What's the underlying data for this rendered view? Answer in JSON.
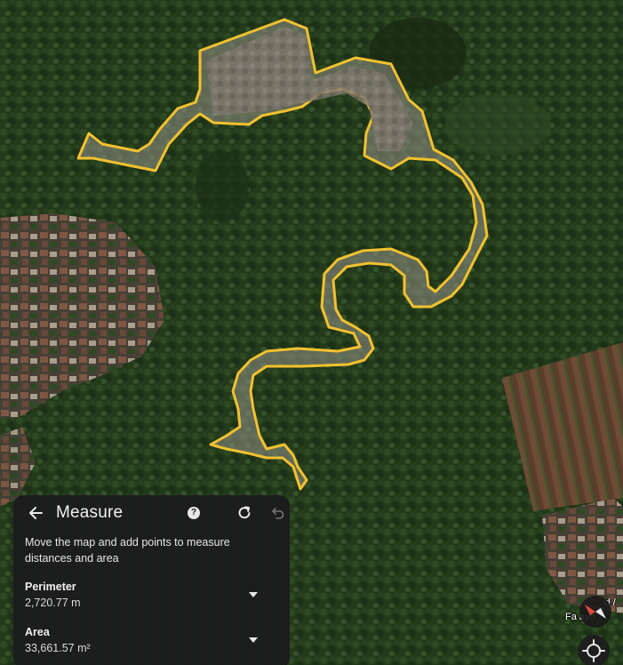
{
  "panel": {
    "title": "Measure",
    "description": "Move the map and add points to measure distances and area",
    "metrics": [
      {
        "label": "Perimeter",
        "value": "2,720.77 m"
      },
      {
        "label": "Area",
        "value": "33,661.57 m²"
      }
    ],
    "help_glyph": "?"
  },
  "map_labels": {
    "poi_fragment_top": "id /",
    "poi_fragment_bottom": "Fa   ayo"
  },
  "colors": {
    "polygon_stroke": "#f2c12e",
    "panel_bg": "#1c1c1e",
    "forest": "#243a1c"
  },
  "icons": [
    "back-arrow-icon",
    "help-icon",
    "reset-icon",
    "undo-icon",
    "compass-icon",
    "locate-icon"
  ]
}
